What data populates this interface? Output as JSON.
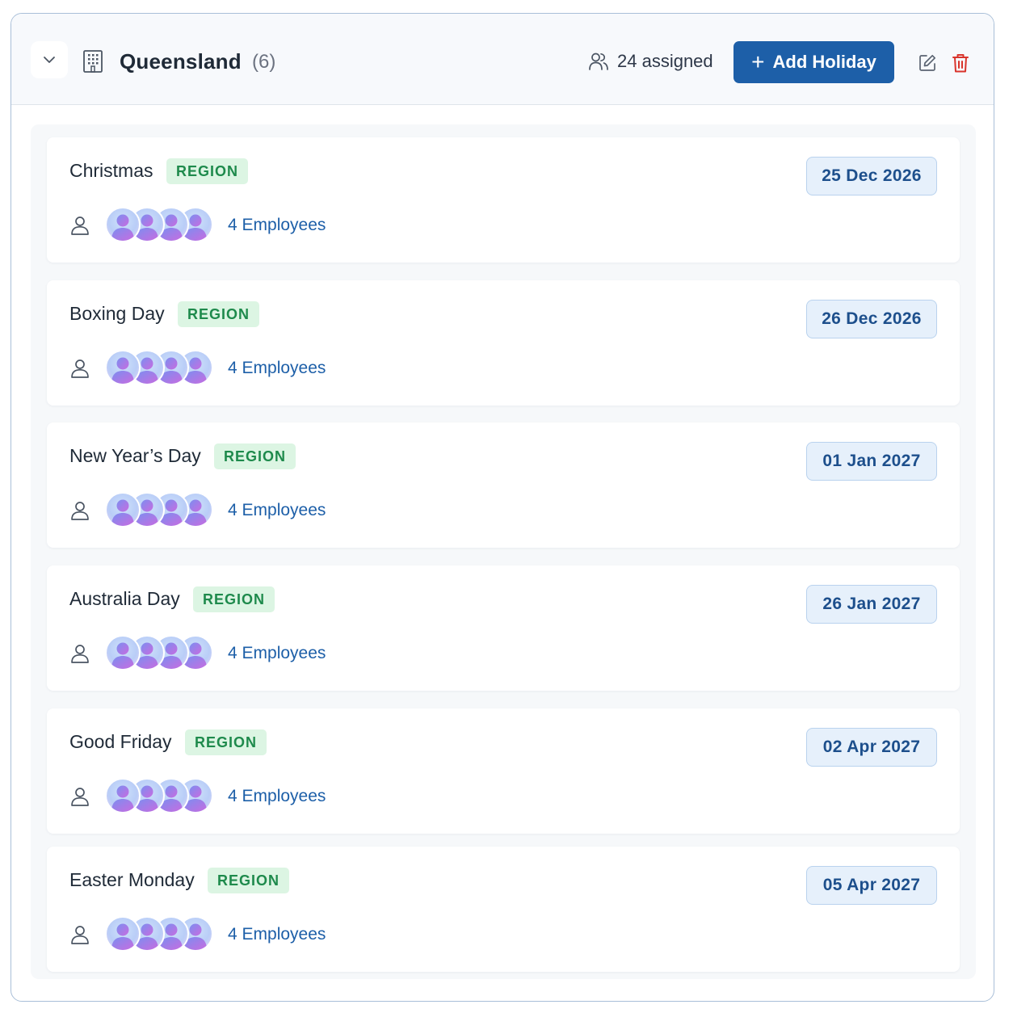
{
  "region": {
    "name": "Queensland",
    "count": "(6)",
    "assigned": "24 assigned",
    "add_button": "Add Holiday",
    "add_button_icon": "plus-icon"
  },
  "icons": {
    "collapse": "chevron-down-icon",
    "building": "building-icon",
    "users": "users-icon",
    "edit": "edit-icon",
    "delete": "trash-icon",
    "person": "person-icon"
  },
  "colors": {
    "primary": "#1d5fa8",
    "badge_bg": "#dcf5e3",
    "badge_text": "#1e8a4c",
    "delete": "#d9342b",
    "date_bg": "#e6f0fb"
  },
  "holidays": [
    {
      "name": "Christmas",
      "badge": "REGION",
      "date": "25 Dec 2026",
      "employees": "4 Employees"
    },
    {
      "name": "Boxing Day",
      "badge": "REGION",
      "date": "26 Dec 2026",
      "employees": "4 Employees"
    },
    {
      "name": "New Year’s Day",
      "badge": "REGION",
      "date": "01 Jan 2027",
      "employees": "4 Employees"
    },
    {
      "name": "Australia Day",
      "badge": "REGION",
      "date": "26 Jan 2027",
      "employees": "4 Employees"
    },
    {
      "name": "Good Friday",
      "badge": "REGION",
      "date": "02 Apr 2027",
      "employees": "4 Employees"
    },
    {
      "name": "Easter Monday",
      "badge": "REGION",
      "date": "05 Apr 2027",
      "employees": "4 Employees"
    }
  ]
}
